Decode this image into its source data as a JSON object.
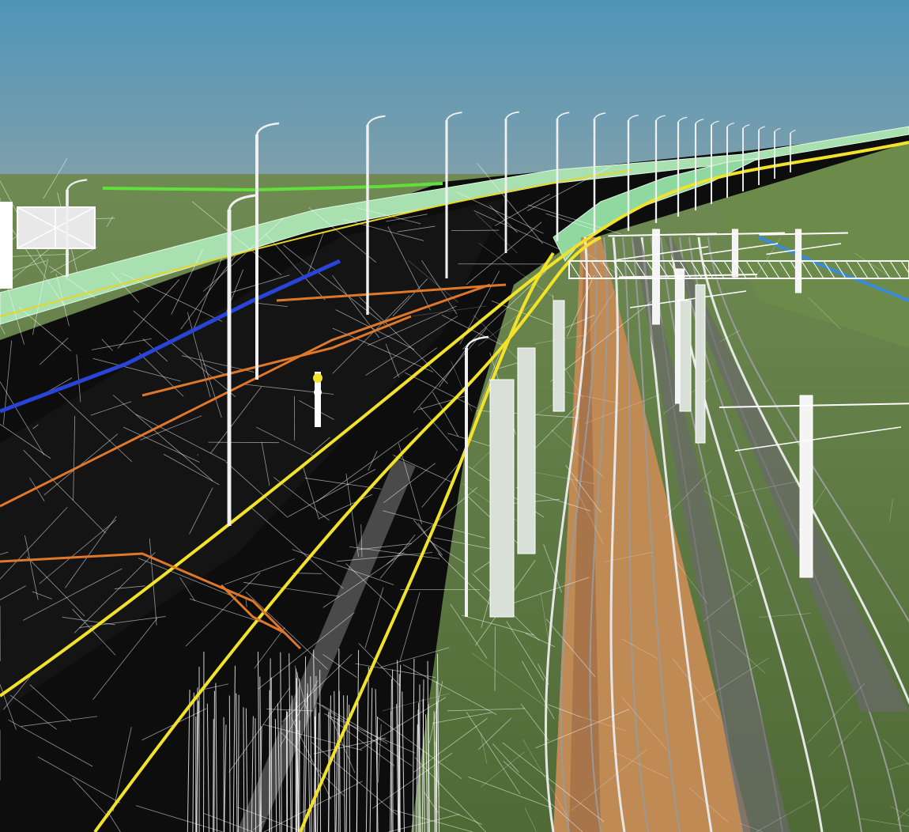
{
  "scene": {
    "description_name": "bim-wireframe-viaduct-render",
    "colors": {
      "sky_top": "#4f95b8",
      "sky_bottom": "#8fa3a8",
      "ground": "#56703a",
      "asphalt": "#0d0d0d",
      "wire": "#ffffff",
      "lane_yellow": "#f2e22a",
      "utility_orange": "#e0782a",
      "utility_blue": "#2a44d8",
      "noise_barrier": "#a8e0b0",
      "ballast_brown": "#c08a55",
      "rail_gray": "#707070",
      "pipe_green": "#5fe03a"
    },
    "icons": [
      "overhead-sign-gantry",
      "street-light",
      "catenary-mast",
      "traffic-signal"
    ]
  }
}
